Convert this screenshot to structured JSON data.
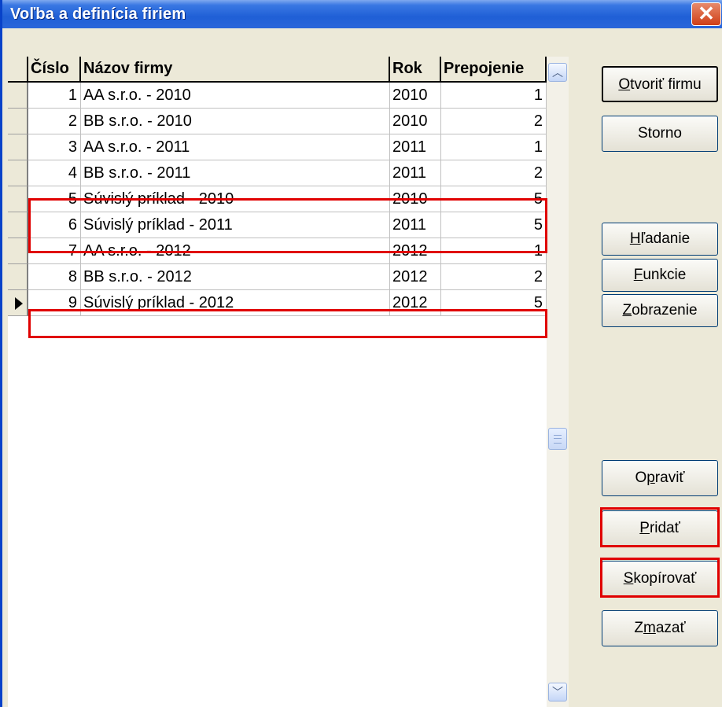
{
  "window": {
    "title": "Voľba a definícia firiem"
  },
  "grid": {
    "columns": [
      "Číslo",
      "Názov firmy",
      "Rok",
      "Prepojenie"
    ],
    "rows": [
      {
        "cislo": "1",
        "nazov": "AA s.r.o. - 2010",
        "rok": "2010",
        "prepojenie": "1"
      },
      {
        "cislo": "2",
        "nazov": "BB s.r.o. - 2010",
        "rok": "2010",
        "prepojenie": "2"
      },
      {
        "cislo": "3",
        "nazov": "AA s.r.o. - 2011",
        "rok": "2011",
        "prepojenie": "1"
      },
      {
        "cislo": "4",
        "nazov": "BB s.r.o. - 2011",
        "rok": "2011",
        "prepojenie": "2"
      },
      {
        "cislo": "5",
        "nazov": "Súvislý príklad - 2010",
        "rok": "2010",
        "prepojenie": "5"
      },
      {
        "cislo": "6",
        "nazov": "Súvislý príklad - 2011",
        "rok": "2011",
        "prepojenie": "5"
      },
      {
        "cislo": "7",
        "nazov": "AA s.r.o. - 2012",
        "rok": "2012",
        "prepojenie": "1"
      },
      {
        "cislo": "8",
        "nazov": "BB s.r.o. - 2012",
        "rok": "2012",
        "prepojenie": "2"
      },
      {
        "cislo": "9",
        "nazov": "Súvislý príklad - 2012",
        "rok": "2012",
        "prepojenie": "5"
      }
    ],
    "current_row": 9
  },
  "buttons": {
    "otvorit": {
      "pre": "",
      "key": "O",
      "post": "tvoriť firmu"
    },
    "storno": {
      "pre": "Storno",
      "key": "",
      "post": ""
    },
    "hladanie": {
      "pre": "",
      "key": "H",
      "post": "ľadanie"
    },
    "funkcie": {
      "pre": "",
      "key": "F",
      "post": "unkcie"
    },
    "zobrazenie": {
      "pre": "",
      "key": "Z",
      "post": "obrazenie"
    },
    "opravit": {
      "pre": "O",
      "key": "p",
      "post": "raviť"
    },
    "pridat": {
      "pre": "",
      "key": "P",
      "post": "ridať"
    },
    "skopirovat": {
      "pre": "",
      "key": "S",
      "post": "kopírovať"
    },
    "zmazat": {
      "pre": "Z",
      "key": "m",
      "post": "azať"
    }
  },
  "colors": {
    "titlebar": "#1f5fd6",
    "highlight": "#e00000",
    "dialog_bg": "#ece9d8"
  }
}
